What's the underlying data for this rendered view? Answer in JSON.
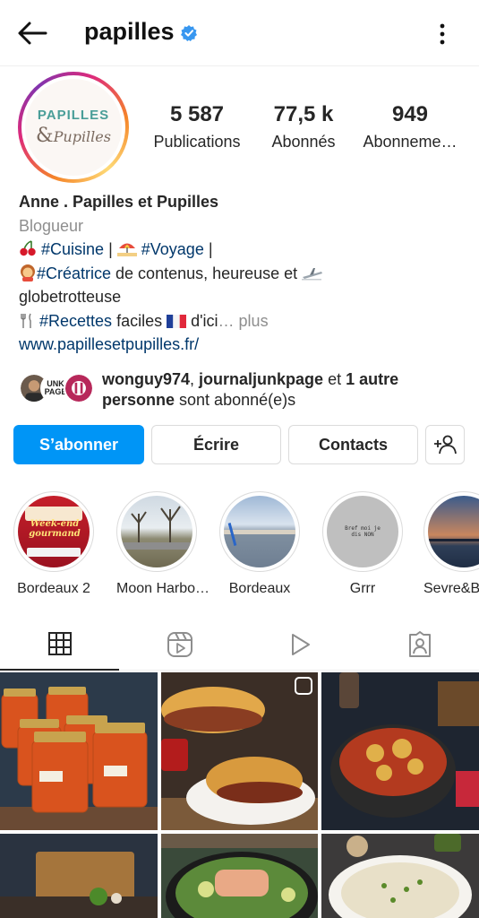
{
  "header": {
    "username": "papilles",
    "back_icon": "arrow-left-icon",
    "verified_icon": "verified-badge-icon",
    "menu_icon": "more-vertical-icon"
  },
  "avatar": {
    "logo_line1": "PAPILLES",
    "logo_amp": "&",
    "logo_line2": "Pupilles"
  },
  "stats": [
    {
      "value": "5 587",
      "label": "Publications"
    },
    {
      "value": "77,5 k",
      "label": "Abonnés"
    },
    {
      "value": "949",
      "label": "Abonneme…"
    }
  ],
  "bio": {
    "name": "Anne . Papilles et Pupilles",
    "category": "Blogueur",
    "line1_tag1": "#Cuisine",
    "line1_sep1": " | ",
    "line1_tag2": "#Voyage",
    "line1_sep2": " |",
    "line2_tag": "#Créatrice",
    "line2_text": " de contenus, heureuse et ",
    "line3_text": "globetrotteuse",
    "line4_tag": "#Recettes",
    "line4_text1": " faciles ",
    "line4_text2": " d'ici",
    "line4_more": "… plus",
    "website": "www.papillesetpupilles.fr/"
  },
  "followed_by": {
    "user1": "wonguy974",
    "sep": ", ",
    "user2": "journaljunkpage",
    "and": " et ",
    "others": "1 autre",
    "others2": "personne",
    "suffix": " sont abonné(e)s",
    "avatar2_text": "UNK\nPAGE"
  },
  "actions": {
    "follow": "S’abonner",
    "message": "Écrire",
    "contacts": "Contacts",
    "add_user_icon": "add-person-icon"
  },
  "highlights": [
    {
      "label": "Bordeaux 2",
      "caption": "Week-end gourmand"
    },
    {
      "label": "Moon Harbo…"
    },
    {
      "label": "Bordeaux"
    },
    {
      "label": "Grrr",
      "caption": "Bref moi je dis NON"
    },
    {
      "label": "Sevre&B"
    }
  ],
  "tabs": [
    {
      "icon": "grid-icon",
      "active": true
    },
    {
      "icon": "reels-icon",
      "active": false
    },
    {
      "icon": "play-icon",
      "active": false
    },
    {
      "icon": "tagged-icon",
      "active": false
    }
  ],
  "colors": {
    "primary_blue": "#0095f6",
    "link_blue": "#00376b",
    "text": "#262626",
    "secondary": "#8e8e8e",
    "verified": "#3897f0"
  }
}
